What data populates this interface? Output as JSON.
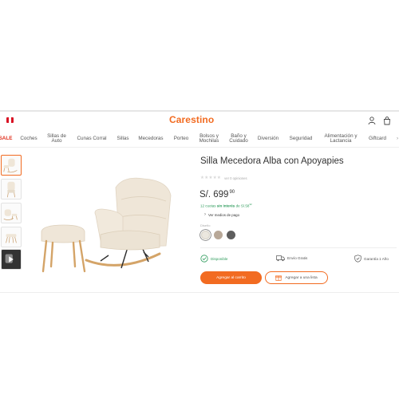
{
  "header": {
    "logo_text": "Carestino",
    "brand_color": "#f26b21",
    "flag_icon": "peru-flag-icon",
    "icons": [
      "user-icon",
      "cart-icon"
    ]
  },
  "nav": {
    "items": [
      {
        "label": "SALE"
      },
      {
        "label": "Coches"
      },
      {
        "label": "Sillas de\nAuto"
      },
      {
        "label": "Cunas Corral"
      },
      {
        "label": "Sillas"
      },
      {
        "label": "Mecedoras"
      },
      {
        "label": "Porteo"
      },
      {
        "label": "Bolsos y\nMochilas"
      },
      {
        "label": "Baño y\nCuidado"
      },
      {
        "label": "Diversión"
      },
      {
        "label": "Seguridad"
      },
      {
        "label": "Alimentación y\nLactancia"
      },
      {
        "label": "Giftcard"
      }
    ]
  },
  "product": {
    "title": "Silla Mecedora Alba con Apoyapies",
    "stars": "★★★★★",
    "reviews": "ver 0 opiniones",
    "price_currency": "S/.",
    "price_int": "699",
    "price_dec": "90",
    "installments_prefix": "12 cuotas",
    "installments_bold": "sin interés",
    "installments_suffix": "de S/.58",
    "installments_sup": "32",
    "payment_link": "Ver medios de pago",
    "color_label": "Diseño",
    "swatches": [
      {
        "name": "cream",
        "color": "#ebe7df",
        "selected": true
      },
      {
        "name": "taupe",
        "color": "#b8a898",
        "selected": false
      },
      {
        "name": "grey",
        "color": "#5e5e5e",
        "selected": false
      }
    ],
    "thumbnails": [
      "product-thumb-1",
      "product-thumb-2",
      "product-thumb-3",
      "product-thumb-4",
      "product-thumb-video"
    ]
  },
  "features": {
    "available": "Disponible",
    "shipping": "Envío Gratis",
    "warranty": "Garantía 1 Año"
  },
  "actions": {
    "add_to_cart": "Agregar al carrito",
    "add_to_list": "Agregar a una lista"
  }
}
